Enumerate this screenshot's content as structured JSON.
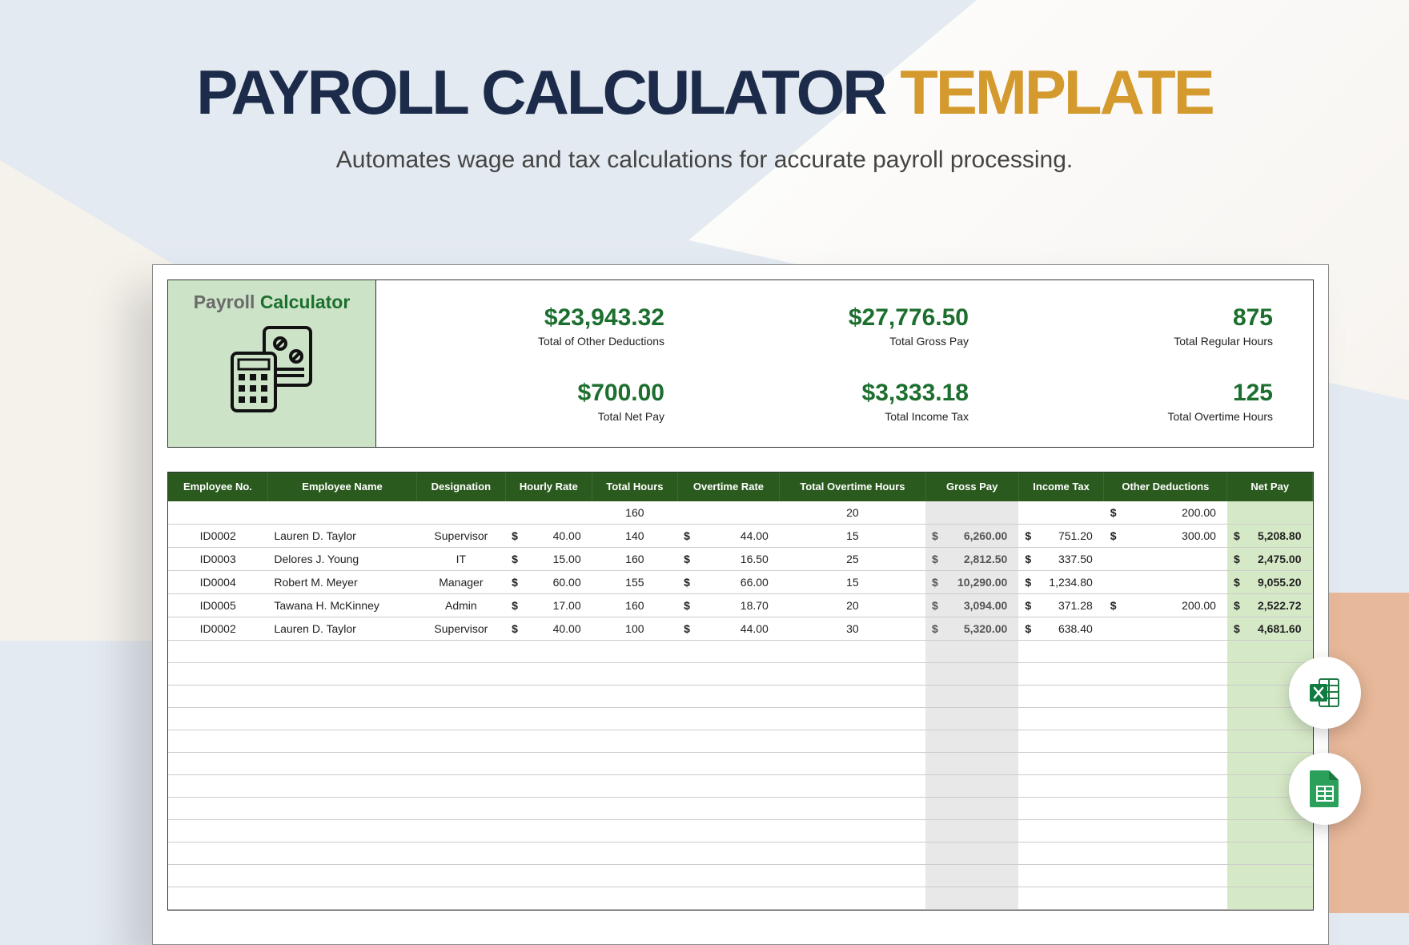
{
  "title": {
    "part1": "PAYROLL CALCULATOR",
    "part2": "TEMPLATE"
  },
  "subtitle": "Automates wage and tax calculations for accurate payroll processing.",
  "card_title": {
    "p1": "Payroll",
    "p2": "Calculator"
  },
  "stats": {
    "other_deductions": {
      "value": "$23,943.32",
      "label": "Total of Other Deductions"
    },
    "gross_pay": {
      "value": "$27,776.50",
      "label": "Total Gross Pay"
    },
    "regular_hours": {
      "value": "875",
      "label": "Total Regular Hours"
    },
    "net_pay": {
      "value": "$700.00",
      "label": "Total Net Pay"
    },
    "income_tax": {
      "value": "$3,333.18",
      "label": "Total Income Tax"
    },
    "overtime_hours": {
      "value": "125",
      "label": "Total Overtime Hours"
    }
  },
  "headers": [
    "Employee No.",
    "Employee Name",
    "Designation",
    "Hourly Rate",
    "Total Hours",
    "Overtime Rate",
    "Total Overtime Hours",
    "Gross Pay",
    "Income Tax",
    "Other Deductions",
    "Net Pay"
  ],
  "rows": [
    {
      "id": "",
      "name": "",
      "desig": "",
      "hrate": "",
      "hours": "160",
      "orate": "",
      "ohrs": "20",
      "gross": "",
      "tax": "",
      "ded": "200.00",
      "net": ""
    },
    {
      "id": "ID0002",
      "name": "Lauren D. Taylor",
      "desig": "Supervisor",
      "hrate": "40.00",
      "hours": "140",
      "orate": "44.00",
      "ohrs": "15",
      "gross": "6,260.00",
      "tax": "751.20",
      "ded": "300.00",
      "net": "5,208.80"
    },
    {
      "id": "ID0003",
      "name": "Delores J. Young",
      "desig": "IT",
      "hrate": "15.00",
      "hours": "160",
      "orate": "16.50",
      "ohrs": "25",
      "gross": "2,812.50",
      "tax": "337.50",
      "ded": "",
      "net": "2,475.00"
    },
    {
      "id": "ID0004",
      "name": "Robert M. Meyer",
      "desig": "Manager",
      "hrate": "60.00",
      "hours": "155",
      "orate": "66.00",
      "ohrs": "15",
      "gross": "10,290.00",
      "tax": "1,234.80",
      "ded": "",
      "net": "9,055.20"
    },
    {
      "id": "ID0005",
      "name": "Tawana H. McKinney",
      "desig": "Admin",
      "hrate": "17.00",
      "hours": "160",
      "orate": "18.70",
      "ohrs": "20",
      "gross": "3,094.00",
      "tax": "371.28",
      "ded": "200.00",
      "net": "2,522.72"
    },
    {
      "id": "ID0002",
      "name": "Lauren D. Taylor",
      "desig": "Supervisor",
      "hrate": "40.00",
      "hours": "100",
      "orate": "44.00",
      "ohrs": "30",
      "gross": "5,320.00",
      "tax": "638.40",
      "ded": "",
      "net": "4,681.60"
    }
  ],
  "empty_rows": 12,
  "icons": {
    "excel": "excel-icon",
    "sheets": "sheets-icon"
  }
}
